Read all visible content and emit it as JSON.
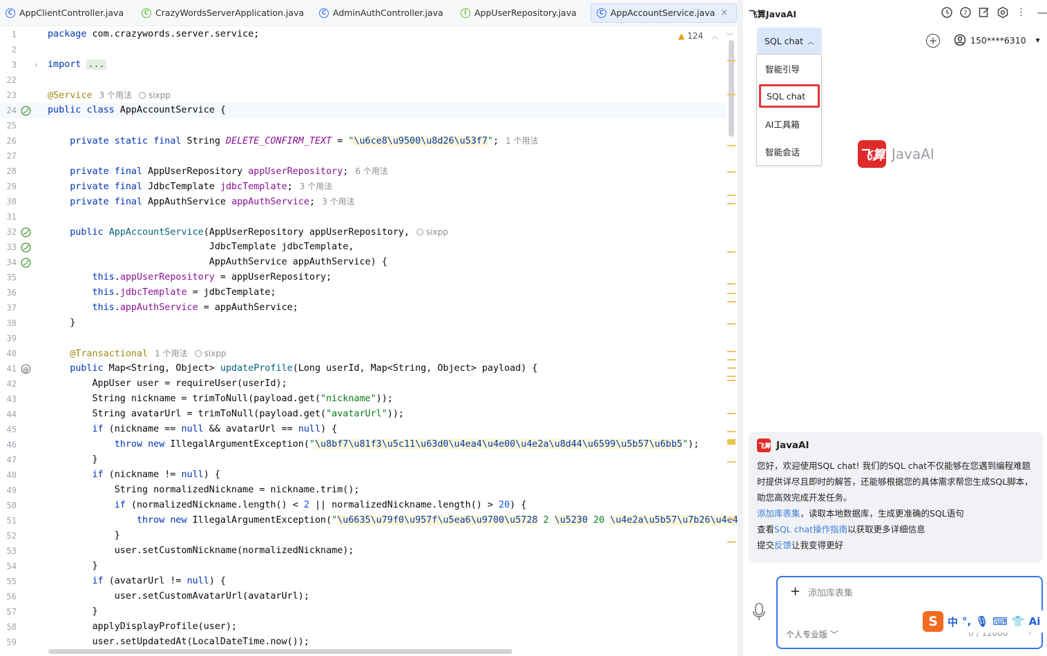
{
  "tabs": [
    {
      "label": "AppClientController.java",
      "icon": "class-icon",
      "glyph": "C"
    },
    {
      "label": "CrazyWordsServerApplication.java",
      "icon": "spring-app-icon",
      "glyph": "C"
    },
    {
      "label": "AdminAuthController.java",
      "icon": "class-icon",
      "glyph": "C"
    },
    {
      "label": "AppUserRepository.java",
      "icon": "interface-icon",
      "glyph": "I"
    },
    {
      "label": "AppAccountService.java",
      "icon": "class-icon",
      "glyph": "C",
      "active": true
    }
  ],
  "editor": {
    "warning_count": "124",
    "lines": [
      {
        "n": "1",
        "c": "package",
        "rest": " com.crazywords.server.service;"
      },
      {
        "n": "2"
      },
      {
        "n": "3",
        "c": "import",
        "rest": " ..."
      },
      {
        "n": "22"
      },
      {
        "n": "23",
        "ann": "@Service",
        "usage": "3 个用法",
        "author": "sixpp"
      },
      {
        "n": "24",
        "text": "public class AppAccountService {"
      },
      {
        "n": "25"
      },
      {
        "n": "26",
        "text": "    private static final String DELETE_CONFIRM_TEXT = \"\\u6ce8\\u9500\\u8d26\\u53f7\";",
        "usage": "1 个用法"
      },
      {
        "n": "27"
      },
      {
        "n": "28",
        "text": "    private final AppUserRepository appUserRepository;",
        "usage": "6 个用法"
      },
      {
        "n": "29",
        "text": "    private final JdbcTemplate jdbcTemplate;",
        "usage": "3 个用法"
      },
      {
        "n": "30",
        "text": "    private final AppAuthService appAuthService;",
        "usage": "3 个用法"
      },
      {
        "n": "31"
      },
      {
        "n": "32",
        "text": "    public AppAccountService(AppUserRepository appUserRepository,",
        "author": "sixpp"
      },
      {
        "n": "33",
        "text": "                             JdbcTemplate jdbcTemplate,"
      },
      {
        "n": "34",
        "text": "                             AppAuthService appAuthService) {"
      },
      {
        "n": "35",
        "text": "        this.appUserRepository = appUserRepository;"
      },
      {
        "n": "36",
        "text": "        this.jdbcTemplate = jdbcTemplate;"
      },
      {
        "n": "37",
        "text": "        this.appAuthService = appAuthService;"
      },
      {
        "n": "38",
        "text": "    }"
      },
      {
        "n": "39"
      },
      {
        "n": "40",
        "ann": "    @Transactional",
        "usage": "1 个用法",
        "author": "sixpp"
      },
      {
        "n": "41",
        "text": "    public Map<String, Object> updateProfile(Long userId, Map<String, Object> payload) {"
      },
      {
        "n": "42",
        "text": "        AppUser user = requireUser(userId);"
      },
      {
        "n": "43",
        "text": "        String nickname = trimToNull(payload.get(\"nickname\"));"
      },
      {
        "n": "44",
        "text": "        String avatarUrl = trimToNull(payload.get(\"avatarUrl\"));"
      },
      {
        "n": "45",
        "text": "        if (nickname == null && avatarUrl == null) {"
      },
      {
        "n": "46",
        "text": "            throw new IllegalArgumentException(\"\\u8bf7\\u81f3\\u5c11\\u63d0\\u4ea4\\u4e00\\u4e2a\\u8d44\\u6599\\u5b57\\u6bb5\");"
      },
      {
        "n": "47",
        "text": "        }"
      },
      {
        "n": "48",
        "text": "        if (nickname != null) {"
      },
      {
        "n": "49",
        "text": "            String normalizedNickname = nickname.trim();"
      },
      {
        "n": "50",
        "text": "            if (normalizedNickname.length() < 2 || normalizedNickname.length() > 20) {"
      },
      {
        "n": "51",
        "text": "                throw new IllegalArgumentException(\"\\u6635\\u79f0\\u957f\\u5ea6\\u9700\\u5728 2 \\u5230 20 \\u4e2a\\u5b57\\u7b26\\u4e4b"
      },
      {
        "n": "52",
        "text": "            }"
      },
      {
        "n": "53",
        "text": "            user.setCustomNickname(normalizedNickname);"
      },
      {
        "n": "54",
        "text": "        }"
      },
      {
        "n": "55",
        "text": "        if (avatarUrl != null) {"
      },
      {
        "n": "56",
        "text": "            user.setCustomAvatarUrl(avatarUrl);"
      },
      {
        "n": "57",
        "text": "        }"
      },
      {
        "n": "58",
        "text": "        applyDisplayProfile(user);"
      },
      {
        "n": "59",
        "text": "        user.setUpdatedAt(LocalDateTime.now());"
      }
    ]
  },
  "panel": {
    "title": "飞算JavaAI",
    "mode_button": "SQL chat",
    "menu": [
      "智能引导",
      "SQL chat",
      "AI工具箱",
      "智能会话"
    ],
    "menu_selected": 1,
    "user": "150****6310",
    "brand_logo": "飞算",
    "brand_text": "JavaAI",
    "message": {
      "sender": "JavaAI",
      "intro": "您好，欢迎使用SQL chat! 我们的SQL chat不仅能够在您遇到编程难题时提供详尽且即时的解答，还能够根据您的具体需求帮您生成SQL脚本，助您高效完成开发任务。",
      "line1_link": "添加库表集",
      "line1_text": "，读取本地数据库，生成更准确的SQL语句",
      "line2_pre": "查看",
      "line2_link": "SQL chat操作指南",
      "line2_post": "以获取更多详细信息",
      "line3_pre": "提交",
      "line3_link": "反馈",
      "line3_post": "让我变得更好"
    },
    "input": {
      "placeholder": "添加库表集",
      "version": "个人专业版",
      "count": "0 / 12000"
    },
    "ime": {
      "logo": "S",
      "lang": "中"
    }
  }
}
